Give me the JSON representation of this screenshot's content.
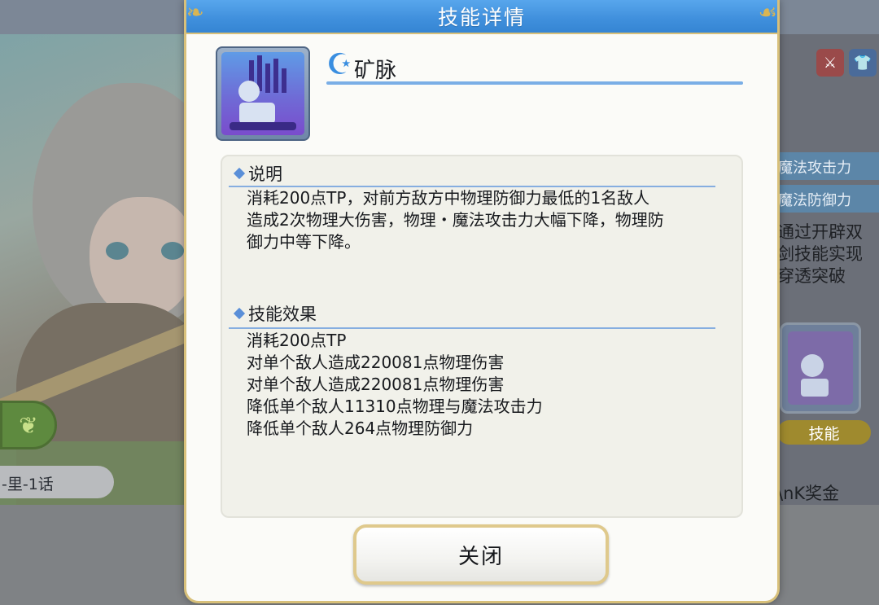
{
  "dialog": {
    "title": "技能详情",
    "skill_name": "矿脉",
    "close_label": "关闭"
  },
  "description": {
    "heading": "说明",
    "text": "消耗200点TP，对前方敌方中物理防御力最低的1名敌人\n造成2次物理大伤害，物理・魔法攻击力大幅下降，物理防\n御力中等下降。"
  },
  "effects": {
    "heading": "技能效果",
    "lines": [
      "消耗200点TP",
      "对单个敌人造成220081点物理伤害",
      "对单个敌人造成220081点物理伤害",
      "降低单个敌人11310点物理与魔法攻击力",
      "降低单个敌人264点物理防御力"
    ]
  },
  "background": {
    "chapter_label": "-里-1话",
    "stat_labels": [
      "魔法攻击力",
      "魔法防御力"
    ],
    "right_desc": "通过开辟双\n剑技能实现\n穿透突破",
    "skill_label": "技能",
    "prize_label": "\\nK奖金"
  },
  "colors": {
    "header_blue": "#3f8fdc",
    "border_gold": "#d8c07a",
    "section_line": "#86aee0",
    "icon_purple": "#7a4ccc"
  },
  "icons": {
    "skill": "skill-figure-icon",
    "corner": "ornament-icon",
    "swirl": "swirl-icon"
  }
}
